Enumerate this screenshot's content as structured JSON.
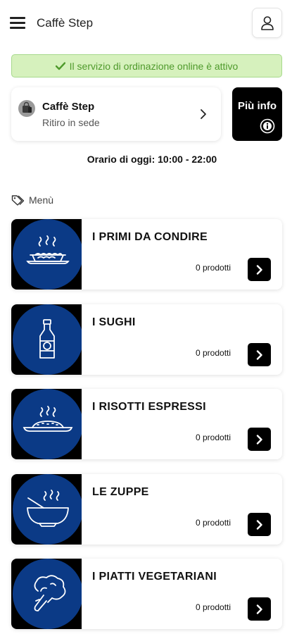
{
  "header": {
    "title": "Caffè Step"
  },
  "status_banner": {
    "text": "Il servizio di ordinazione online è attivo",
    "color": "#4f9a2c"
  },
  "store": {
    "name": "Caffè Step",
    "mode": "Ritiro in sede"
  },
  "info_button": {
    "label": "Più info"
  },
  "hours": {
    "text": "Orario di oggi: 10:00 - 22:00"
  },
  "menu": {
    "label": "Menù",
    "categories": [
      {
        "title": "I PRIMI DA CONDIRE",
        "count": "0 prodotti",
        "icon": "pasta-dish-icon"
      },
      {
        "title": "I SUGHI",
        "count": "0 prodotti",
        "icon": "sauce-bottle-icon"
      },
      {
        "title": "I RISOTTI ESPRESSI",
        "count": "0 prodotti",
        "icon": "risotto-plate-icon"
      },
      {
        "title": "LE ZUPPE",
        "count": "0 prodotti",
        "icon": "soup-bowl-icon"
      },
      {
        "title": "I PIATTI VEGETARIANI",
        "count": "0 prodotti",
        "icon": "broccoli-icon"
      }
    ]
  },
  "colors": {
    "category_circle": "#0b3a86",
    "banner_bg": "#d6f1bd",
    "button_dark": "#000000"
  }
}
